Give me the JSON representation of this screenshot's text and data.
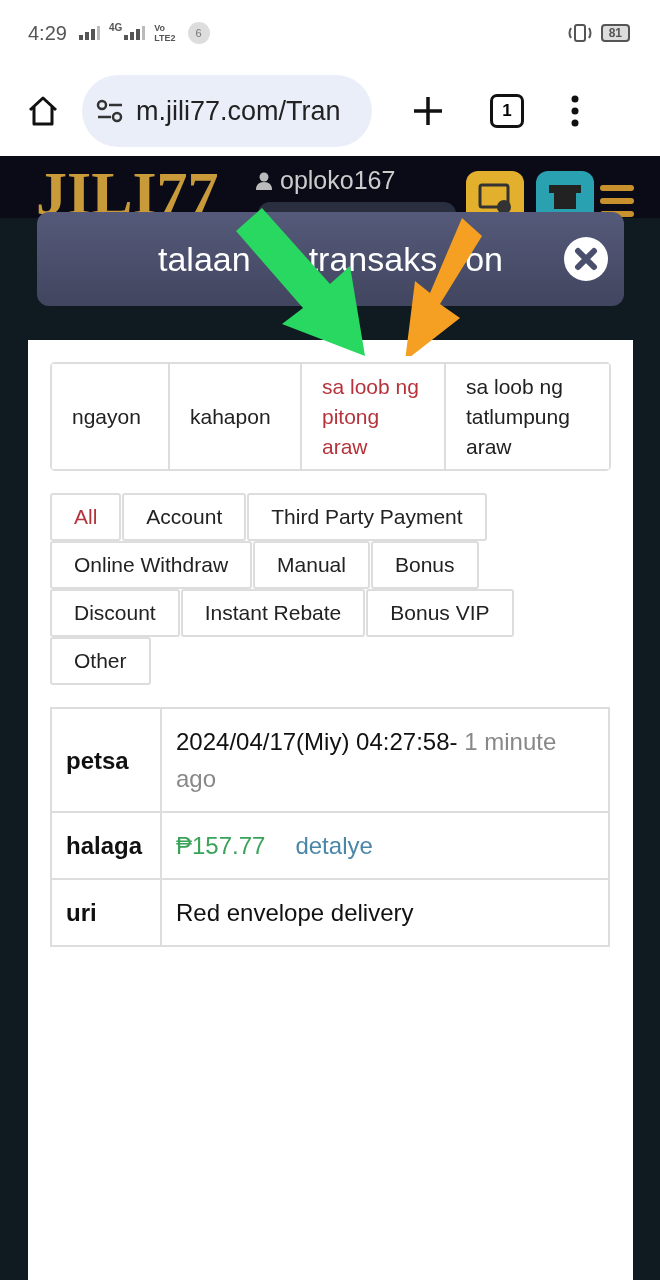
{
  "status_bar": {
    "time": "4:29",
    "network": "4G",
    "volte": "Vo",
    "lte": "LTE2",
    "notification_count": "6",
    "battery": "81"
  },
  "browser": {
    "url": "m.jili77.com/Tran",
    "tab_count": "1"
  },
  "site_header": {
    "logo": "JILI77",
    "username": "oploko167"
  },
  "modal": {
    "title_parts": [
      "talaan",
      "transaks",
      "on"
    ],
    "period_tabs": [
      {
        "label": "ngayon",
        "selected": false
      },
      {
        "label": "kahapon",
        "selected": false
      },
      {
        "label": "sa loob ng pitong araw",
        "selected": true
      },
      {
        "label": "sa loob ng tatlumpung araw",
        "selected": false
      }
    ],
    "filter_chips": [
      {
        "label": "All",
        "selected": true
      },
      {
        "label": "Account",
        "selected": false
      },
      {
        "label": "Third Party Payment",
        "selected": false
      },
      {
        "label": "Online Withdraw",
        "selected": false
      },
      {
        "label": "Manual",
        "selected": false
      },
      {
        "label": "Bonus",
        "selected": false
      },
      {
        "label": "Discount",
        "selected": false
      },
      {
        "label": "Instant Rebate",
        "selected": false
      },
      {
        "label": "Bonus VIP",
        "selected": false
      },
      {
        "label": "Other",
        "selected": false
      }
    ],
    "details": [
      {
        "label": "petsa",
        "kind": "datetime",
        "value": "2024/04/17(Miy) 04:27:58-",
        "note": "1 minute ago"
      },
      {
        "label": "halaga",
        "kind": "amount",
        "value": "₱157.77",
        "link": "detalye"
      },
      {
        "label": "uri",
        "kind": "text",
        "value": "Red envelope delivery"
      }
    ]
  }
}
